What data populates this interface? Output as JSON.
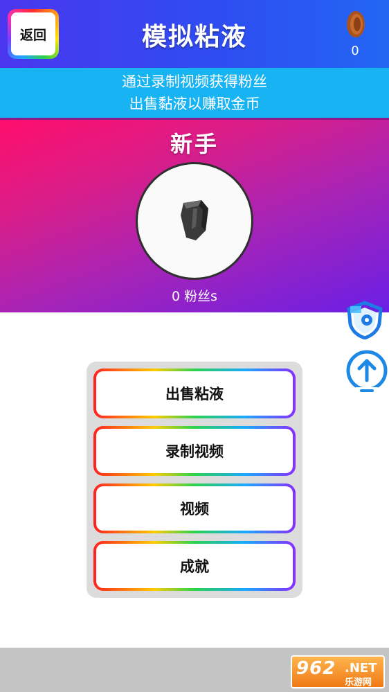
{
  "header": {
    "back_label": "返回",
    "title": "模拟粘液",
    "coins": "0"
  },
  "banner": {
    "line1": "通过录制视频获得粉丝",
    "line2": "出售黏液以赚取金币"
  },
  "profile": {
    "rank": "新手",
    "fans": "0 粉丝s"
  },
  "menu": {
    "items": [
      {
        "label": "出售粘液"
      },
      {
        "label": "录制视频"
      },
      {
        "label": "视频"
      },
      {
        "label": "成就"
      }
    ]
  },
  "side_icons": [
    "shield-icon",
    "upload-icon"
  ],
  "watermark": {
    "brand": "962",
    "net": ".NET",
    "sub": "乐游网"
  },
  "colors": {
    "header": "#3f45f0",
    "banner": "#18b3f3",
    "profile_start": "#ff0e6c",
    "profile_end": "#6a1fe6",
    "panel": "#dcdcdc",
    "bottom_bar": "#c4c4c4"
  }
}
